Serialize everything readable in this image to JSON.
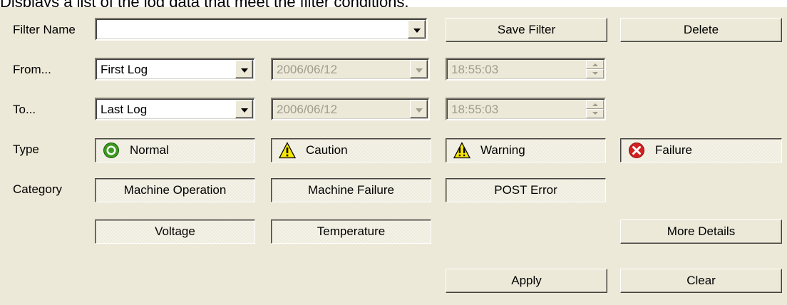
{
  "caption": "Displays a list of the log data that meet the filter conditions.",
  "filter": {
    "label": "Filter Name",
    "value": "",
    "save_label": "Save Filter",
    "delete_label": "Delete"
  },
  "from": {
    "label": "From...",
    "selection": "First Log",
    "date": "2006/06/12",
    "time": "18:55:03"
  },
  "to": {
    "label": "To...",
    "selection": "Last Log",
    "date": "2006/06/12",
    "time": "18:55:03"
  },
  "type": {
    "label": "Type",
    "items": [
      {
        "label": "Normal",
        "icon": "normal-icon",
        "color": "#3c9a1e"
      },
      {
        "label": "Caution",
        "icon": "caution-icon",
        "color": "#f7e600"
      },
      {
        "label": "Warning",
        "icon": "warning-icon",
        "color": "#f7e600"
      },
      {
        "label": "Failure",
        "icon": "failure-icon",
        "color": "#d42020"
      }
    ]
  },
  "category": {
    "label": "Category",
    "items": [
      "Machine Operation",
      "Machine Failure",
      "POST Error",
      "Voltage",
      "Temperature"
    ]
  },
  "actions": {
    "more_details": "More Details",
    "apply": "Apply",
    "clear": "Clear"
  }
}
